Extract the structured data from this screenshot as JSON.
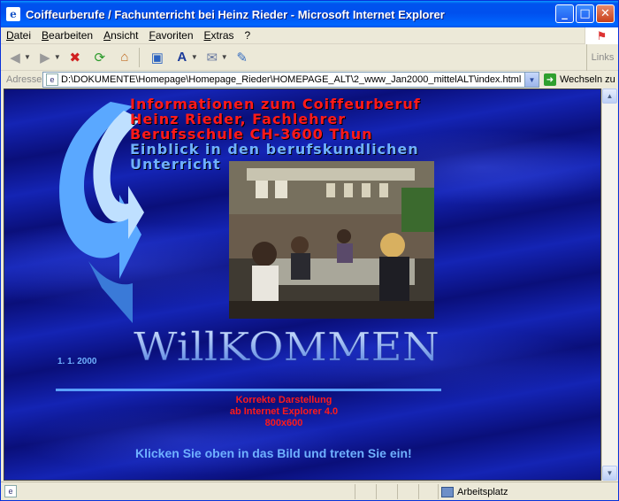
{
  "window": {
    "title": "Coiffeurberufe / Fachunterricht bei Heinz Rieder - Microsoft Internet Explorer",
    "min_label": "_",
    "max_label": "□",
    "close_label": "✕"
  },
  "menu": {
    "items": [
      "Datei",
      "Bearbeiten",
      "Ansicht",
      "Favoriten",
      "Extras",
      "?"
    ]
  },
  "toolbar": {
    "links_label": "Links"
  },
  "address": {
    "label": "Adresse",
    "url": "D:\\DOKUMENTE\\Homepage\\Homepage_Rieder\\HOMEPAGE_ALT\\2_www_Jan2000_mittelALT\\index.html",
    "go_label": "Wechseln zu"
  },
  "page": {
    "heading_lines": [
      "Informationen zum Coiffeurberuf",
      "Heinz Rieder, Fachlehrer",
      "Berufsschule CH-3600 Thun",
      "Einblick in den berufskundlichen",
      "Unterricht"
    ],
    "willkommen": "WillKOMMEN",
    "date": "1. 1. 2000",
    "notice_lines": [
      "Korrekte Darstellung",
      "ab Internet Explorer 4.0",
      "800x600"
    ],
    "enter_text": "Klicken Sie oben in das Bild und treten Sie ein!"
  },
  "status": {
    "zone": "Arbeitsplatz"
  },
  "colors": {
    "heading_red": "#ff1a1a",
    "heading_blue": "#6fb1ff",
    "page_background": "#0a0f7a"
  }
}
